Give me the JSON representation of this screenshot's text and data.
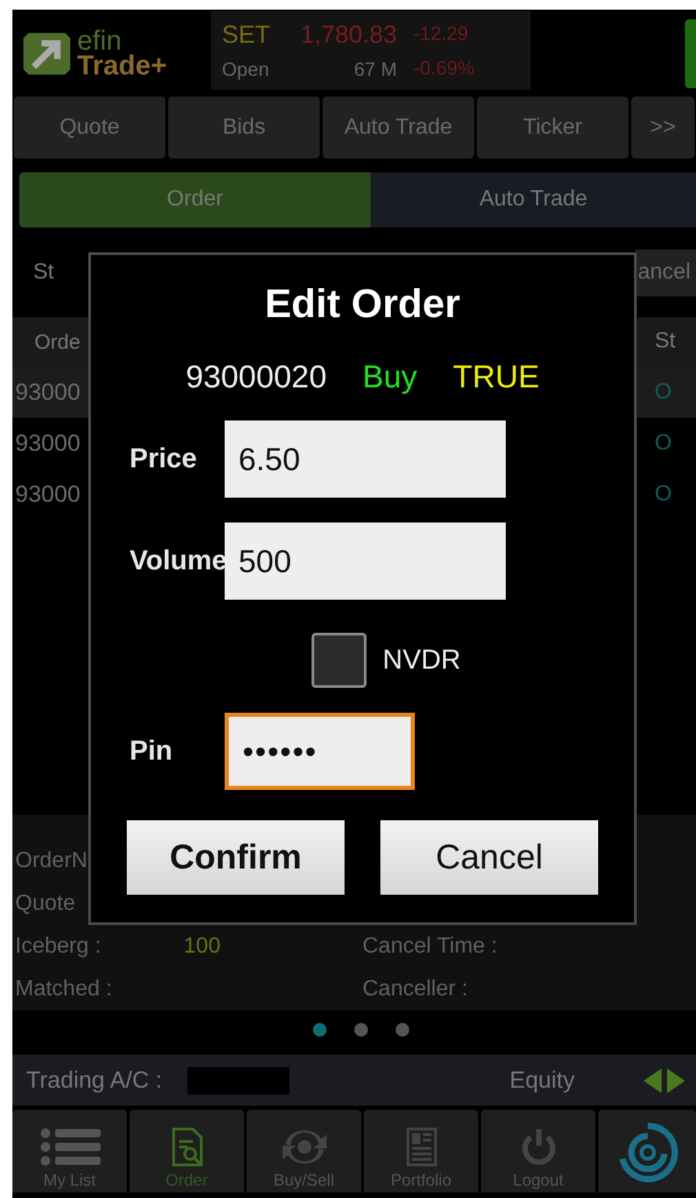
{
  "header": {
    "logo_top": "efin",
    "logo_bottom": "Trade+",
    "index": {
      "name": "SET",
      "status": "Open",
      "value": "1,780.83",
      "change": "-12.29",
      "volume": "67 M",
      "percent": "-0.69%"
    }
  },
  "tabs": [
    {
      "label": "Quote"
    },
    {
      "label": "Bids"
    },
    {
      "label": "Auto Trade"
    },
    {
      "label": "Ticker"
    },
    {
      "label": ">>"
    }
  ],
  "segments": [
    {
      "label": "Order",
      "selected": true
    },
    {
      "label": "Auto Trade",
      "selected": false
    }
  ],
  "filter": {
    "label": "St",
    "button_fragment": "ancel"
  },
  "table": {
    "columns": [
      "Orde",
      "St"
    ],
    "rows": [
      {
        "order_no": "93000",
        "status": "O",
        "selected": true
      },
      {
        "order_no": "93000",
        "status": "O",
        "selected": false
      },
      {
        "order_no": "93000",
        "status": "O",
        "selected": false
      }
    ]
  },
  "details": {
    "left": [
      {
        "label": "OrderN"
      },
      {
        "label": "Quote"
      },
      {
        "label": "Iceberg :",
        "value": "100"
      },
      {
        "label": "Matched :"
      }
    ],
    "right": [
      {
        "label": "Cancel Time :"
      },
      {
        "label": "Canceller :"
      }
    ]
  },
  "pager": [
    {
      "selected": true
    },
    {
      "selected": false
    },
    {
      "selected": false
    }
  ],
  "account": {
    "label": "Trading A/C :",
    "type": "Equity"
  },
  "nav": [
    {
      "kind": "list",
      "label": "My List",
      "selected": false
    },
    {
      "kind": "order",
      "label": "Order",
      "selected": true
    },
    {
      "kind": "buysell",
      "label": "Buy/Sell",
      "selected": false
    },
    {
      "kind": "portfolio",
      "label": "Portfolio",
      "selected": false
    },
    {
      "kind": "logout",
      "label": "Logout",
      "selected": false
    },
    {
      "kind": "spinner"
    }
  ],
  "dialog": {
    "title": "Edit Order",
    "order_no": "93000020",
    "side": "Buy",
    "symbol": "TRUE",
    "fields": [
      {
        "label": "Price",
        "value": "6.50"
      },
      {
        "label": "Volume",
        "value": "500"
      }
    ],
    "nvdr": {
      "label": "NVDR",
      "checked": false
    },
    "pin": {
      "label": "Pin",
      "value": "••••••",
      "focused": true
    },
    "buttons": [
      "Confirm",
      "Cancel"
    ]
  }
}
